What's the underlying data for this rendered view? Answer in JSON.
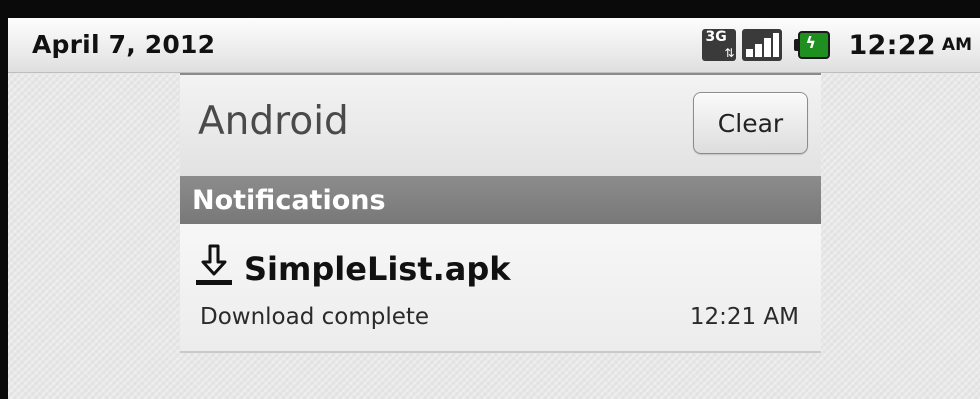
{
  "statusbar": {
    "date": "April 7, 2012",
    "network_label": "3G",
    "time": "12:22",
    "ampm": "AM",
    "icons": [
      "network-3g-icon",
      "signal-strength-icon",
      "battery-charging-icon"
    ],
    "battery_color": "#1f8f1f"
  },
  "panel": {
    "carrier": "Android",
    "clear_label": "Clear",
    "section_label": "Notifications",
    "notifications": [
      {
        "icon": "download-icon",
        "title": "SimpleList.apk",
        "text": "Download complete",
        "time": "12:21 AM"
      }
    ]
  }
}
